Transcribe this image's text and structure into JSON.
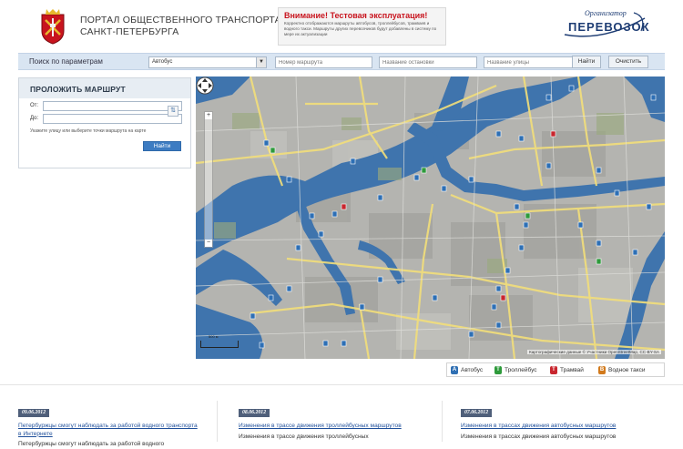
{
  "header": {
    "portal_title_line1": "ПОРТАЛ ОБЩЕСТВЕННОГО ТРАНСПОРТА",
    "portal_title_line2": "САНКТ-ПЕТЕРБУРГА",
    "warning_title": "Внимание! Тестовая эксплуатация!",
    "warning_text": "Корректно отображаются маршруты автобусов, троллейбусов, трамваев и водного такси. Маршруты других перевозчиков будут добавлены в систему по мере их актуализации",
    "org_logo_small": "Организатор",
    "org_logo_big": "ПЕРЕВОЗОК"
  },
  "search": {
    "label": "Поиск по параметрам",
    "transport_selected": "Автобус",
    "route_number_placeholder": "Номер маршрута",
    "stop_name_placeholder": "Название остановки",
    "street_name_placeholder": "Название улицы",
    "find_label": "Найти",
    "clear_label": "Очистить"
  },
  "route": {
    "title": "ПРОЛОЖИТЬ МАРШРУТ",
    "from_label": "От:",
    "to_label": "До:",
    "swap_icon": "swap-arrows-icon",
    "hint": "Укажите улицу или выберите точки маршрута на карте",
    "find_label": "Найти"
  },
  "map": {
    "scale_label": "500 м",
    "attribution": "Картографические данные © Участники OpenStreetMap, CC-BY-SA"
  },
  "legend": [
    {
      "label": "Автобус",
      "letter": "А",
      "color": "#2f6fb3"
    },
    {
      "label": "Троллейбус",
      "letter": "Т",
      "color": "#2e9a3b"
    },
    {
      "label": "Трамвай",
      "letter": "Т",
      "color": "#c8262e"
    },
    {
      "label": "Водное такси",
      "letter": "В",
      "color": "#d27a1c"
    }
  ],
  "news": [
    {
      "date": "09.06.2012",
      "title": "Петербуржцы смогут наблюдать за работой водного транспорта в Интернете",
      "text": "Петербуржцы смогут наблюдать за работой водного"
    },
    {
      "date": "08.06.2012",
      "title": "Изменения в трассе движения троллейбусных маршрутов",
      "text": "Изменения в трассе движения троллейбусных"
    },
    {
      "date": "07.06.2012",
      "title": "Изменения в трассах движения автобусных маршрутов",
      "text": "Изменения в трассах движения автобусных маршрутов"
    }
  ]
}
